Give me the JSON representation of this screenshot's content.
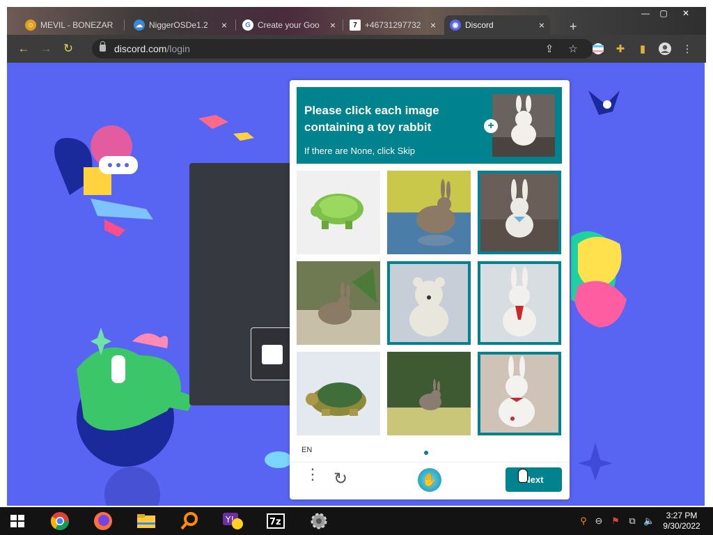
{
  "browser": {
    "tabs": [
      {
        "label": "MEVIL - BONEZAR",
        "favicon": "bonezar-icon",
        "color": "#e0a020"
      },
      {
        "label": "NiggerOSDe1.2",
        "favicon": "cloud-icon",
        "color": "#3a88d8"
      },
      {
        "label": "Create your Goo",
        "favicon": "google-icon",
        "color": "#ffffff"
      },
      {
        "label": "+46731297732",
        "favicon": "seven-icon",
        "color": "#111111"
      },
      {
        "label": "Discord",
        "favicon": "discord-icon",
        "color": "#5865f2"
      }
    ],
    "url_host": "discord.com",
    "url_path": "/login",
    "active_tab_index": 4
  },
  "captcha": {
    "prompt_title": "Please click each image containing a toy rabbit",
    "prompt_sub": "If there are None, click Skip",
    "language": "EN",
    "next_label": "Next",
    "tiles": [
      {
        "subject": "turtle toy",
        "selected": false
      },
      {
        "subject": "rabbit photo",
        "selected": false
      },
      {
        "subject": "toy rabbit",
        "selected": true
      },
      {
        "subject": "rabbit photo",
        "selected": false
      },
      {
        "subject": "toy bear",
        "selected": true
      },
      {
        "subject": "toy rabbit",
        "selected": true
      },
      {
        "subject": "turtle toy",
        "selected": false
      },
      {
        "subject": "rabbit photo",
        "selected": false
      },
      {
        "subject": "toy rabbit",
        "selected": true
      }
    ],
    "accent": "#00838f"
  },
  "page": {
    "background": "#5865f2"
  },
  "taskbar": {
    "apps": [
      "windows-start-icon",
      "chrome-icon",
      "firefox-icon",
      "file-explorer-icon",
      "search-magnifier-icon",
      "yahoo-messenger-icon",
      "7zip-icon",
      "settings-gear-icon"
    ],
    "time": "3:27 PM",
    "date": "9/30/2022"
  }
}
